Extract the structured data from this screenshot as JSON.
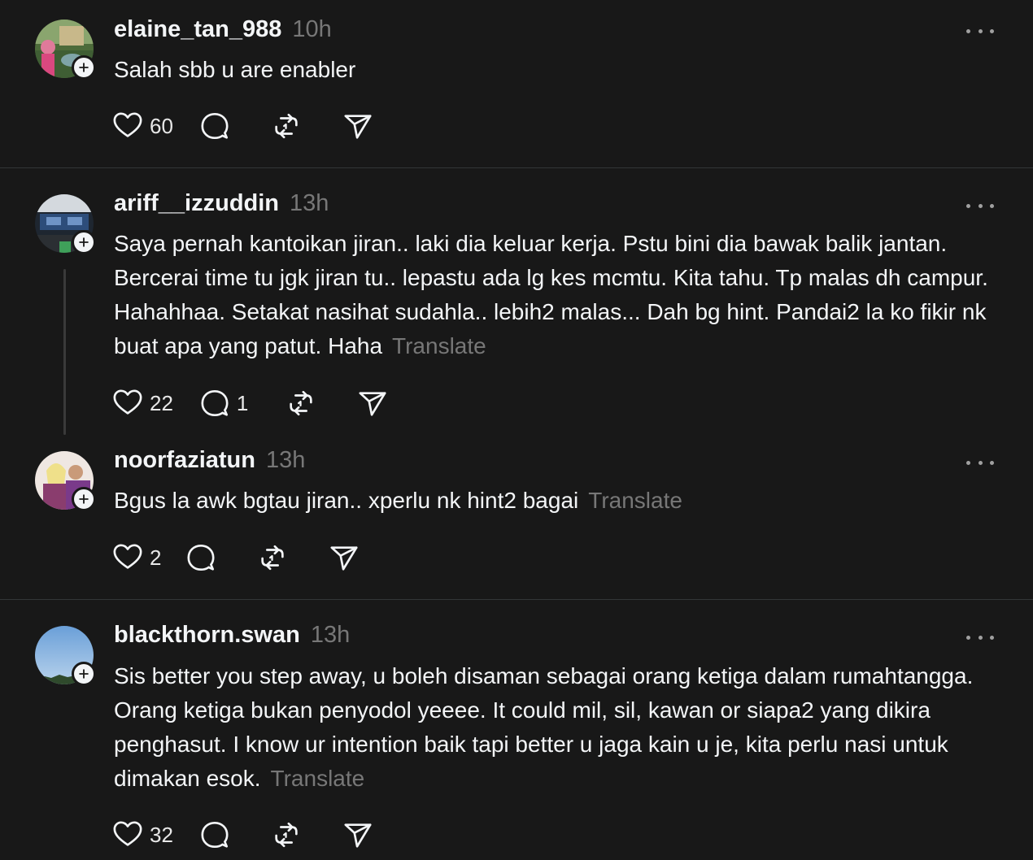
{
  "colors": {
    "background": "#181818",
    "text": "#f3f5f7",
    "muted": "#777777",
    "divider": "#333638"
  },
  "posts": [
    {
      "username": "elaine_tan_988",
      "time": "10h",
      "text": "Salah sbb u are enabler",
      "translate": "",
      "likes": "60",
      "replies": "",
      "avatar": "avatar-photo-garden"
    },
    {
      "username": "ariff__izzuddin",
      "time": "13h",
      "text": "Saya pernah kantoikan jiran.. laki dia keluar kerja. Pstu bini dia bawak balik jantan. Bercerai time tu jgk jiran tu.. lepastu ada lg kes mcmtu. Kita tahu. Tp malas dh campur. Hahahhaa. Setakat nasihat sudahla.. lebih2 malas... Dah bg hint. Pandai2 la ko fikir nk buat apa yang patut. Haha",
      "translate": "Translate",
      "likes": "22",
      "replies": "1",
      "avatar": "avatar-photo-car-dashboard"
    },
    {
      "username": "noorfaziatun",
      "time": "13h",
      "text": "Bgus la awk bgtau jiran.. xperlu nk hint2 bagai",
      "translate": "Translate",
      "likes": "2",
      "replies": "",
      "avatar": "avatar-photo-couple"
    },
    {
      "username": "blackthorn.swan",
      "time": "13h",
      "text": "Sis better you step away, u boleh disaman sebagai orang ketiga dalam rumahtangga. Orang ketiga bukan penyodol yeeee. It could mil, sil, kawan or siapa2 yang dikira penghasut. I know ur intention baik tapi better u jaga kain u je, kita perlu nasi untuk dimakan esok.",
      "translate": "Translate",
      "likes": "32",
      "replies": "",
      "avatar": "avatar-photo-sky"
    }
  ],
  "icons": {
    "like": "heart-icon",
    "reply": "comment-bubble-icon",
    "repost": "repost-icon",
    "share": "send-paper-plane-icon",
    "more": "more-horizontal-icon",
    "follow": "plus-icon"
  }
}
